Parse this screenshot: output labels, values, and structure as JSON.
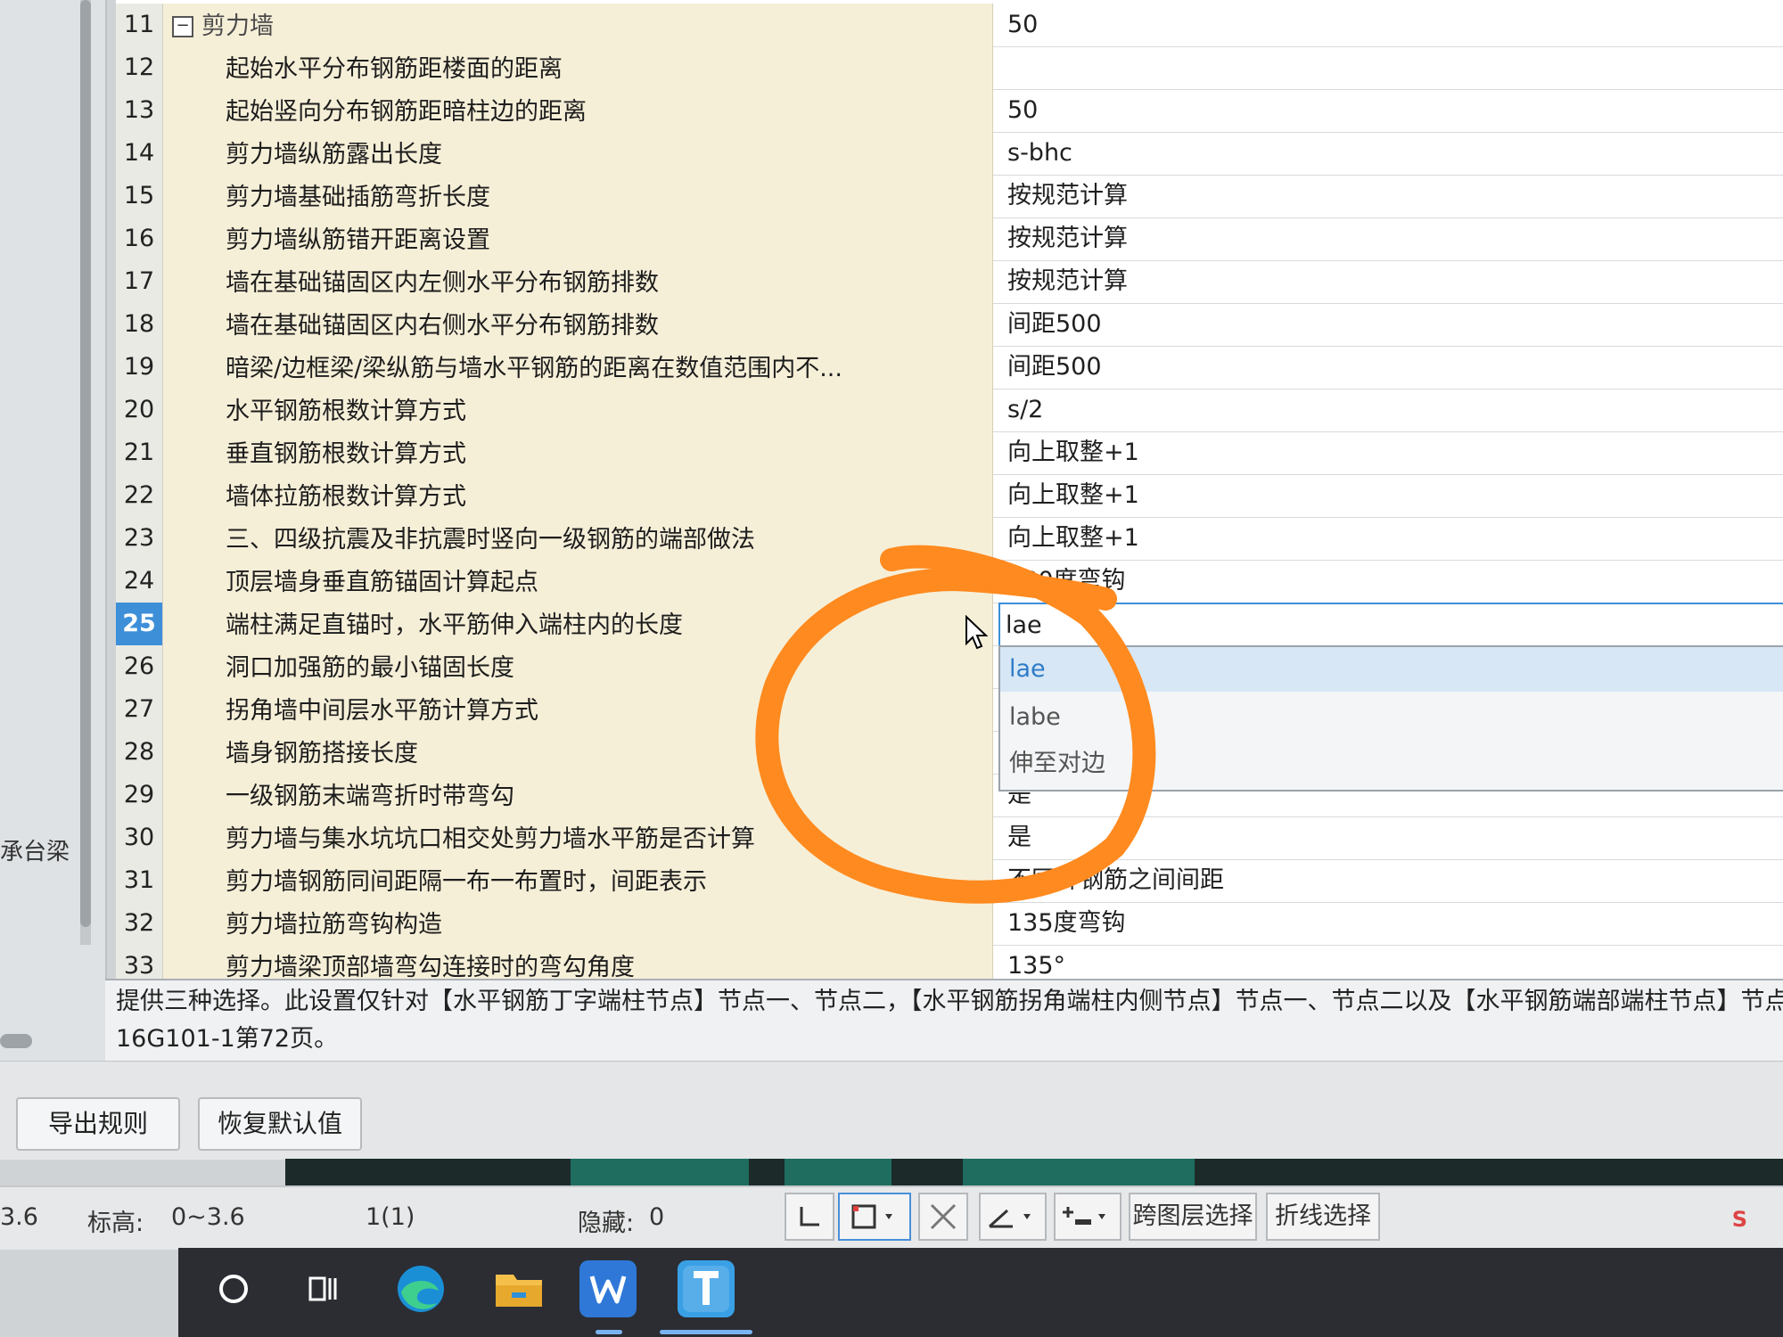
{
  "sidebar": {
    "visible_label": "承台梁"
  },
  "rows": [
    {
      "num": "11",
      "name": "剪力墙",
      "value": "50",
      "group": true
    },
    {
      "num": "12",
      "name": "起始水平分布钢筋距楼面的距离",
      "value": ""
    },
    {
      "num": "13",
      "name": "起始竖向分布钢筋距暗柱边的距离",
      "value": "50"
    },
    {
      "num": "14",
      "name": "剪力墙纵筋露出长度",
      "value": "s-bhc"
    },
    {
      "num": "15",
      "name": "剪力墙基础插筋弯折长度",
      "value": "按规范计算"
    },
    {
      "num": "16",
      "name": "剪力墙纵筋错开距离设置",
      "value": "按规范计算"
    },
    {
      "num": "17",
      "name": "墙在基础锚固区内左侧水平分布钢筋排数",
      "value": "按规范计算"
    },
    {
      "num": "18",
      "name": "墙在基础锚固区内右侧水平分布钢筋排数",
      "value": "间距500"
    },
    {
      "num": "19",
      "name": "暗梁/边框梁/梁纵筋与墙水平钢筋的距离在数值范围内不...",
      "value": "间距500"
    },
    {
      "num": "20",
      "name": "水平钢筋根数计算方式",
      "value": "s/2"
    },
    {
      "num": "21",
      "name": "垂直钢筋根数计算方式",
      "value": "向上取整+1"
    },
    {
      "num": "22",
      "name": "墙体拉筋根数计算方式",
      "value": "向上取整+1"
    },
    {
      "num": "23",
      "name": "三、四级抗震及非抗震时竖向一级钢筋的端部做法",
      "value": "向上取整+1"
    },
    {
      "num": "24",
      "name": "顶层墙身垂直筋锚固计算起点",
      "value": "180度弯钩"
    },
    {
      "num": "25",
      "name": "端柱满足直锚时，水平筋伸入端柱内的长度",
      "value": "lae",
      "selected": true
    },
    {
      "num": "26",
      "name": "洞口加强筋的最小锚固长度",
      "value": ""
    },
    {
      "num": "27",
      "name": "拐角墙中间层水平筋计算方式",
      "value": ""
    },
    {
      "num": "28",
      "name": "墙身钢筋搭接长度",
      "value": ""
    },
    {
      "num": "29",
      "name": "一级钢筋末端弯折时带弯勾",
      "value": "是"
    },
    {
      "num": "30",
      "name": "剪力墙与集水坑坑口相交处剪力墙水平筋是否计算",
      "value": "是"
    },
    {
      "num": "31",
      "name": "剪力墙钢筋同间距隔一布一布置时，间距表示",
      "value": "不同种钢筋之间间距"
    },
    {
      "num": "32",
      "name": "剪力墙拉筋弯钩构造",
      "value": "135度弯钩"
    },
    {
      "num": "33",
      "name": "剪力墙梁顶部墙弯勾连接时的弯勾角度",
      "value": "135°"
    }
  ],
  "dropdown": {
    "options": [
      "lae",
      "labe",
      "伸至对边"
    ],
    "selected_index": 0
  },
  "description": {
    "line1": "提供三种选择。此设置仅针对【水平钢筋丁字端柱节点】节点一、节点二，【水平钢筋拐角端柱内侧节点】节点一、节点二以及【水平钢筋端部端柱节点】节点一有效",
    "line2": "16G101-1第72页。"
  },
  "buttons": {
    "export": "导出规则",
    "restore": "恢复默认值"
  },
  "statusbar": {
    "left_value": "3.6",
    "elevation_label": "标高:",
    "elevation_value": "0~3.6",
    "floor": "1(1)",
    "hidden_label": "隐藏:",
    "hidden_value": "0",
    "cross_layer_select": "跨图层选择",
    "polyline_select": "折线选择"
  },
  "colors": {
    "selected_row": "#3d8fd8",
    "annotation": "#ff8a1f",
    "name_column_bg": "#f6efd8"
  },
  "taskbar": {
    "icons": [
      "search-circle-icon",
      "task-view-icon",
      "edge-browser-icon",
      "file-explorer-icon",
      "wps-writer-icon",
      "app-t-icon"
    ]
  }
}
